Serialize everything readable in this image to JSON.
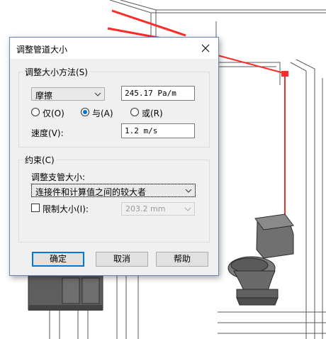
{
  "dialog": {
    "title": "调整管道大小",
    "sizing_method": {
      "group_label": "调整大小方法(S)",
      "method_value": "摩擦",
      "friction_value": "245.17 Pa/m",
      "radio_only": "仅(O)",
      "radio_and": "与(A)",
      "radio_or": "或(R)",
      "selected_radio": "and",
      "velocity_label": "速度(V):",
      "velocity_value": "1.2 m/s"
    },
    "constraints": {
      "group_label": "约束(C)",
      "branch_label": "调整支管大小:",
      "branch_value": "连接件和计算值之间的较大者",
      "restrict_label": "限制大小(I):",
      "restrict_checked": false,
      "restrict_value": "203.2 mm"
    },
    "buttons": {
      "ok": "确定",
      "cancel": "取消",
      "help": "帮助"
    }
  },
  "colors": {
    "pipe_red": "#ff2b2b",
    "accent_blue": "#0078d7"
  }
}
